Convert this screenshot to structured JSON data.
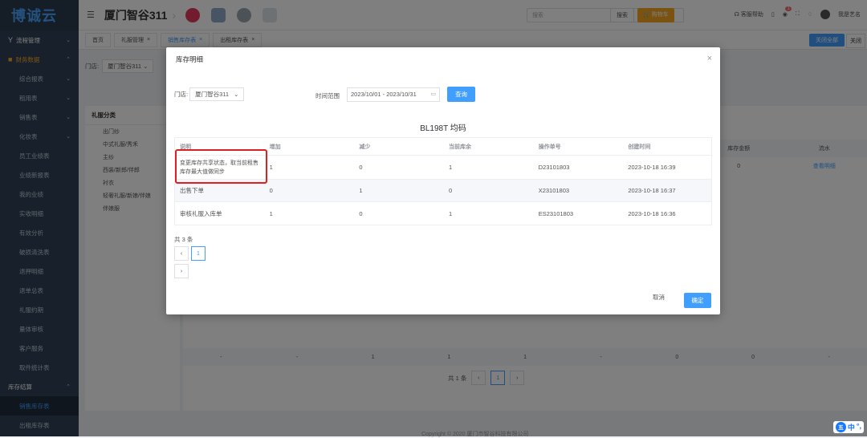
{
  "app": {
    "logo": "博诚云",
    "store_name": "厦门智谷311"
  },
  "header": {
    "search_placeholder": "搜索",
    "search_button": "搜索",
    "cart_button": "购物车",
    "help": "客服帮助",
    "notif_count": "1",
    "user": "我是艺名"
  },
  "sidebar": {
    "items": [
      {
        "label": "流程管理",
        "type": "group",
        "icon": "Y",
        "chev": "⌄"
      },
      {
        "label": "财务数据",
        "type": "group-active",
        "icon": "■",
        "chev": "⌃"
      },
      {
        "label": "综合报表",
        "type": "sub",
        "chev": "⌄"
      },
      {
        "label": "租用表",
        "type": "sub",
        "chev": "⌄"
      },
      {
        "label": "销售表",
        "type": "sub",
        "chev": "⌄"
      },
      {
        "label": "化妆表",
        "type": "sub",
        "chev": "⌄"
      },
      {
        "label": "员工业绩表",
        "type": "sub",
        "chev": ""
      },
      {
        "label": "业绩新报表",
        "type": "sub",
        "chev": ""
      },
      {
        "label": "我的业绩",
        "type": "sub",
        "chev": ""
      },
      {
        "label": "实收明细",
        "type": "sub",
        "chev": ""
      },
      {
        "label": "有效分析",
        "type": "sub",
        "chev": ""
      },
      {
        "label": "破损清洗表",
        "type": "sub",
        "chev": ""
      },
      {
        "label": "退押明细",
        "type": "sub",
        "chev": ""
      },
      {
        "label": "退单总表",
        "type": "sub",
        "chev": ""
      },
      {
        "label": "礼服约期",
        "type": "sub",
        "chev": ""
      },
      {
        "label": "量体审核",
        "type": "sub",
        "chev": ""
      },
      {
        "label": "客户服务",
        "type": "sub",
        "chev": ""
      },
      {
        "label": "取件统计表",
        "type": "sub",
        "chev": ""
      },
      {
        "label": "库存结算",
        "type": "group",
        "icon": "",
        "chev": "⌃"
      },
      {
        "label": "销售库存表",
        "type": "sub-active",
        "chev": ""
      },
      {
        "label": "出租库存表",
        "type": "sub",
        "chev": ""
      }
    ]
  },
  "tabs": {
    "items": [
      "首页",
      "礼服管理",
      "销售库存表",
      "出租库存表"
    ],
    "close_all": "关闭全部",
    "more": "关闭"
  },
  "background": {
    "store_label": "门店:",
    "store_value": "厦门智谷311",
    "category_title": "礼服分类",
    "categories": [
      "出门纱",
      "中式礼服/秀禾",
      "主纱",
      "西装/新郎/伴郎",
      "衬衣",
      "轻奢礼服/新娘/伴娘",
      "伴娘服"
    ],
    "table_cols": [
      "",
      "",
      "",
      "",
      "",
      "",
      "库存金额",
      "流水"
    ],
    "row1": [
      "",
      "",
      "",
      "",
      "",
      "",
      "0",
      "查看明细"
    ],
    "summary": [
      "-",
      "-",
      "1",
      "1",
      "1",
      "-",
      "0",
      "0",
      "-"
    ],
    "total": "共 1 条",
    "page": "1",
    "copyright": "Copyright © 2020 厦门市智谷科技有限公司"
  },
  "modal": {
    "title": "库存明细",
    "store_label": "门店:",
    "store_value": "厦门智谷311",
    "time_label": "时间范围",
    "date_range": "2023/10/01 - 2023/10/31",
    "query_button": "查询",
    "heading": "BL198T 均码",
    "columns": [
      "说明",
      "增加",
      "减少",
      "当前库余",
      "操作单号",
      "创建时间"
    ],
    "rows": [
      {
        "desc": "变更库存共享状态，取当前租售库存最大值做同步",
        "add": "1",
        "sub": "0",
        "remain": "1",
        "order": "D23101803",
        "time": "2023-10-18 16:39"
      },
      {
        "desc": "出售下单",
        "add": "0",
        "sub": "1",
        "remain": "0",
        "order": "X23101803",
        "time": "2023-10-18 16:37"
      },
      {
        "desc": "审核礼服入库单",
        "add": "1",
        "sub": "0",
        "remain": "1",
        "order": "ES23101803",
        "time": "2023-10-18 16:36"
      }
    ],
    "total": "共 3 条",
    "page": "1",
    "cancel": "取消",
    "ok": "确定"
  },
  "ime": {
    "label1": "五",
    "label2": "中",
    "label3": "°,"
  },
  "colors": {
    "primary": "#409eff",
    "sidebar": "#304156",
    "highlight": "#e02020"
  }
}
